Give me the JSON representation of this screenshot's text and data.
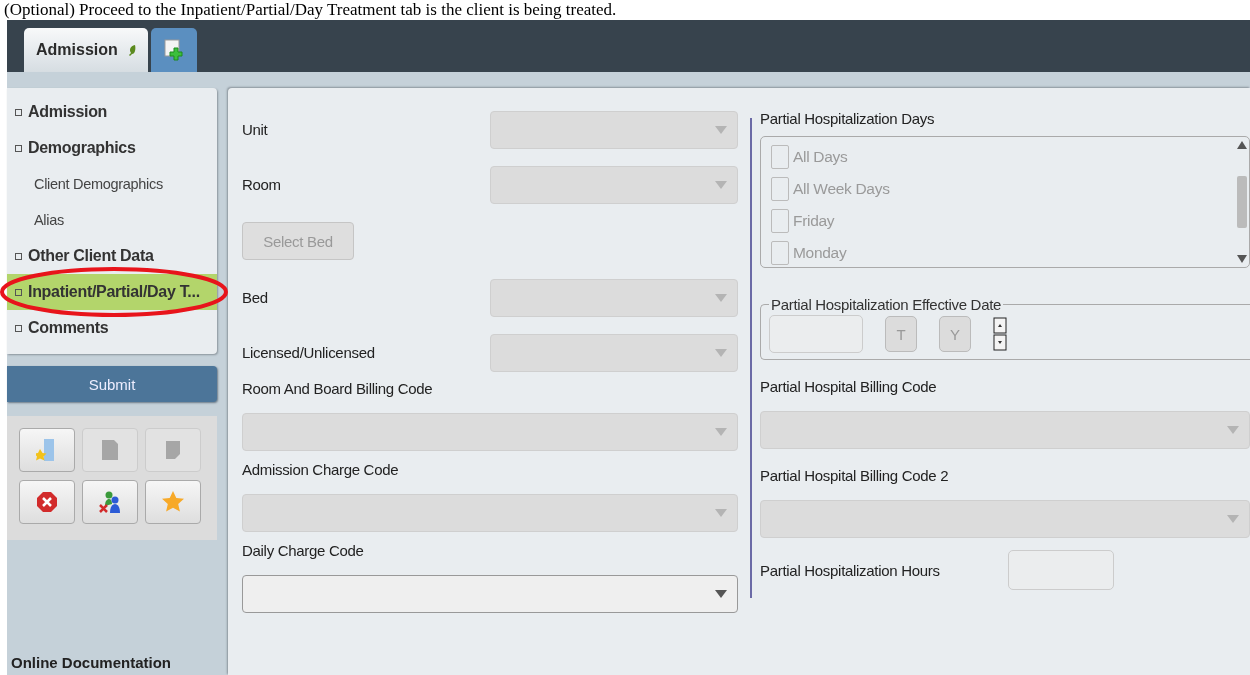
{
  "caption": "(Optional) Proceed to the Inpatient/Partial/Day Treatment tab is the client is being treated.",
  "tabs": [
    {
      "kind": "text",
      "label": "Admission",
      "selected": true
    },
    {
      "kind": "add",
      "selected": false
    }
  ],
  "nav": [
    {
      "label": "Admission",
      "selected": false
    },
    {
      "label": "Demographics",
      "selected": false,
      "children": [
        {
          "label": "Client Demographics",
          "selected": false
        },
        {
          "label": "Alias",
          "selected": false
        }
      ]
    },
    {
      "label": "Other Client Data",
      "selected": false
    },
    {
      "label": "Inpatient/Partial/Day T...",
      "selected": true,
      "annotated": true
    },
    {
      "label": "Comments",
      "selected": false
    }
  ],
  "submit": "Submit",
  "actions": [
    {
      "kind": "folder-star",
      "disabled": false
    },
    {
      "kind": "page",
      "disabled": true
    },
    {
      "kind": "note",
      "disabled": true
    },
    {
      "kind": "cancel",
      "disabled": false
    },
    {
      "kind": "people-x",
      "disabled": false
    },
    {
      "kind": "star",
      "disabled": false
    }
  ],
  "footer_link": "Online Documentation",
  "left_fields": [
    {
      "kind": "inline-select",
      "label": "Unit",
      "disabled": true
    },
    {
      "kind": "inline-select",
      "label": "Room",
      "disabled": true
    },
    {
      "kind": "button",
      "label": "Select Bed",
      "disabled": true
    },
    {
      "kind": "inline-select",
      "label": "Bed",
      "disabled": true
    },
    {
      "kind": "inline-select",
      "label": "Licensed/Unlicensed",
      "disabled": true
    },
    {
      "kind": "stacked-select",
      "label": "Room And Board Billing Code",
      "disabled": true
    },
    {
      "kind": "stacked-select",
      "label": "Admission Charge Code",
      "disabled": true
    },
    {
      "kind": "stacked-select",
      "label": "Daily Charge Code",
      "disabled": false
    }
  ],
  "days": {
    "label": "Partial Hospitalization Days",
    "options": [
      {
        "label": "All Days",
        "checked": false
      },
      {
        "label": "All Week Days",
        "checked": false
      },
      {
        "label": "Friday",
        "checked": false
      },
      {
        "label": "Monday",
        "checked": false
      }
    ]
  },
  "effective_date": {
    "legend": "Partial Hospitalization Effective Date",
    "buttons": [
      "T",
      "Y"
    ]
  },
  "right_fields": [
    {
      "kind": "stacked-select",
      "label": "Partial Hospital Billing Code",
      "disabled": true
    },
    {
      "kind": "stacked-select",
      "label": "Partial Hospital Billing Code 2",
      "disabled": true
    },
    {
      "kind": "inline-input",
      "label": "Partial Hospitalization Hours",
      "disabled": true
    }
  ]
}
